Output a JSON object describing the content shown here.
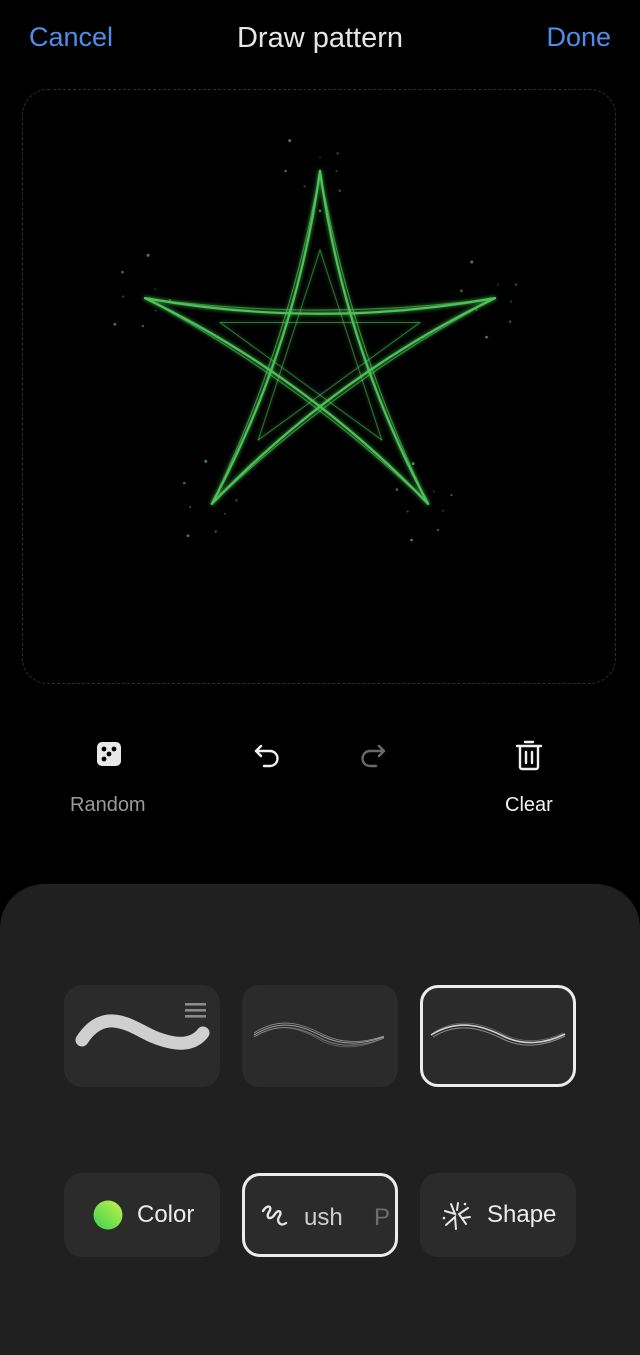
{
  "header": {
    "cancel_label": "Cancel",
    "title": "Draw pattern",
    "done_label": "Done"
  },
  "canvas": {
    "pattern": "pentagram",
    "stroke_color": "#4ec85a"
  },
  "tools": {
    "random_label": "Random",
    "clear_label": "Clear"
  },
  "brushes": [
    {
      "name": "smooth-brush",
      "selected": false
    },
    {
      "name": "fine-brush",
      "selected": false
    },
    {
      "name": "glow-brush",
      "selected": true
    }
  ],
  "tabs": {
    "color_label": "Color",
    "brush_label": "ush",
    "brush_partial_next": "P",
    "shape_label": "Shape",
    "color_swatch_from": "#3ad34f",
    "color_swatch_to": "#c8f04a"
  },
  "colors": {
    "accent": "#4d8fe8",
    "background": "#000000",
    "panel": "#202020"
  }
}
